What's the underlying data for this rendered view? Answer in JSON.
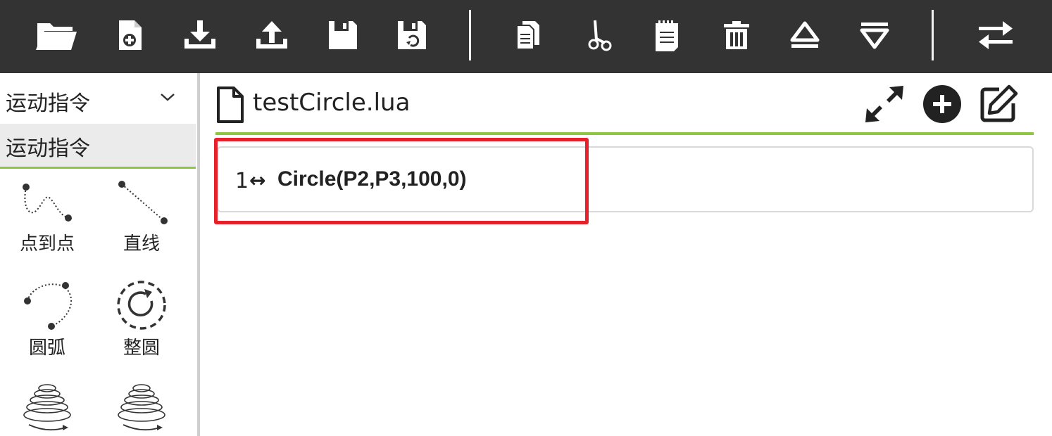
{
  "toolbar": {
    "background": "#333333",
    "buttons": [
      {
        "icon": "folder-open-icon"
      },
      {
        "icon": "new-file-icon"
      },
      {
        "icon": "download-icon"
      },
      {
        "icon": "upload-icon"
      },
      {
        "icon": "save-icon"
      },
      {
        "icon": "save-as-icon"
      },
      {
        "icon": "copy-icon"
      },
      {
        "icon": "cut-icon"
      },
      {
        "icon": "paste-icon"
      },
      {
        "icon": "delete-icon"
      },
      {
        "icon": "move-up-icon"
      },
      {
        "icon": "move-down-icon"
      },
      {
        "icon": "swap-icon"
      }
    ]
  },
  "sidebar": {
    "category_dropdown": "运动指令",
    "active_category": "运动指令",
    "tools": [
      {
        "label": "点到点",
        "icon": "point-to-point-icon"
      },
      {
        "label": "直线",
        "icon": "line-icon"
      },
      {
        "label": "圆弧",
        "icon": "arc-icon"
      },
      {
        "label": "整圆",
        "icon": "full-circle-icon"
      },
      {
        "label": "",
        "icon": "spiral-icon"
      },
      {
        "label": "",
        "icon": "spiral-icon"
      }
    ],
    "accent": "#8dc63f"
  },
  "editor": {
    "filename": "testCircle.lua",
    "lines": [
      {
        "number": "1",
        "arrow": "↔",
        "code": "Circle(P2,P3,100,0)"
      }
    ]
  },
  "colors": {
    "highlight": "#e8202b",
    "rule": "#8dc63f"
  }
}
